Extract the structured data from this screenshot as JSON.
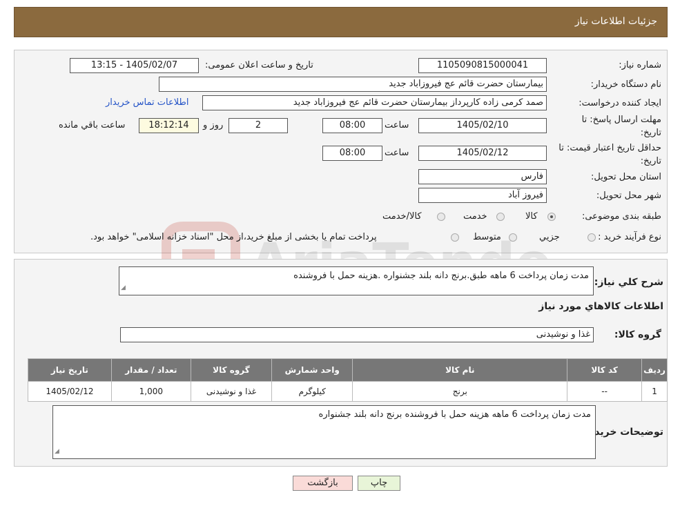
{
  "header": {
    "title": "جزئیات اطلاعات نیاز"
  },
  "details": {
    "need_number_label": "شماره نیاز:",
    "need_number": "1105090815000041",
    "announce_label": "تاریخ و ساعت اعلان عمومی:",
    "announce_value": "1405/02/07 - 13:15",
    "buyer_org_label": "نام دستگاه خریدار:",
    "buyer_org": "بیمارستان حضرت قائم  عج  فیروزاباد جدید",
    "creator_label": "ایجاد کننده درخواست:",
    "creator": "صمد کرمی زاده کارپرداز بیمارستان حضرت قائم  عج  فیروزاباد جدید",
    "contact_link": "اطلاعات تماس خریدار",
    "deadline_label": "مهلت ارسال پاسخ: تا تاریخ:",
    "deadline_date": "1405/02/10",
    "time_label": "ساعت",
    "deadline_time": "08:00",
    "days_value": "2",
    "days_label": "روز و",
    "remaining_time": "18:12:14",
    "remaining_label": "ساعت باقي مانده",
    "validity_label": "حداقل تاریخ اعتبار قیمت: تا تاریخ:",
    "validity_date": "1405/02/12",
    "validity_time": "08:00",
    "province_label": "استان محل تحویل:",
    "province": "فارس",
    "city_label": "شهر محل تحویل:",
    "city": "فیروز آباد",
    "category_label": "طبقه بندی موضوعی:",
    "category_options": [
      "کالا",
      "خدمت",
      "کالا/خدمت"
    ],
    "process_label": "نوع فرآیند خرید :",
    "process_options": [
      "جزیي",
      "متوسط"
    ],
    "process_note": "پرداخت تمام یا بخشی از مبلغ خرید،از محل \"اسناد خزانه اسلامی\" خواهد بود."
  },
  "items_section": {
    "description_label": "شرح کلي نياز:",
    "description": "مدت زمان پرداخت 6 ماهه طبق.برنج دانه بلند جشنواره .هزینه حمل با فروشنده",
    "goods_info_title": "اطلاعات کالاهاي مورد نياز",
    "group_label": "گروه کالا:",
    "group_value": "غذا و نوشیدنی",
    "table": {
      "headers": [
        "رديف",
        "کد کالا",
        "نام کالا",
        "واحد شمارش",
        "گروه کالا",
        "تعداد / مقدار",
        "تاريخ نياز"
      ],
      "rows": [
        [
          "1",
          "--",
          "برنج",
          "کیلوگرم",
          "غذا و نوشیدنی",
          "1,000",
          "1405/02/12"
        ]
      ]
    },
    "buyer_notes_label": "توضیحات خریدار:",
    "buyer_notes": "مدت زمان پرداخت 6 ماهه هزینه حمل با فروشنده برنج دانه بلند جشنواره"
  },
  "buttons": {
    "print": "چاپ",
    "back": "بازگشت"
  },
  "watermark": {
    "text": "AriaTender.neT"
  },
  "colors": {
    "header": "#8b6a3e",
    "link": "#2554c7",
    "back_button": "#fadbd8",
    "print_button": "#e8f5d8"
  }
}
